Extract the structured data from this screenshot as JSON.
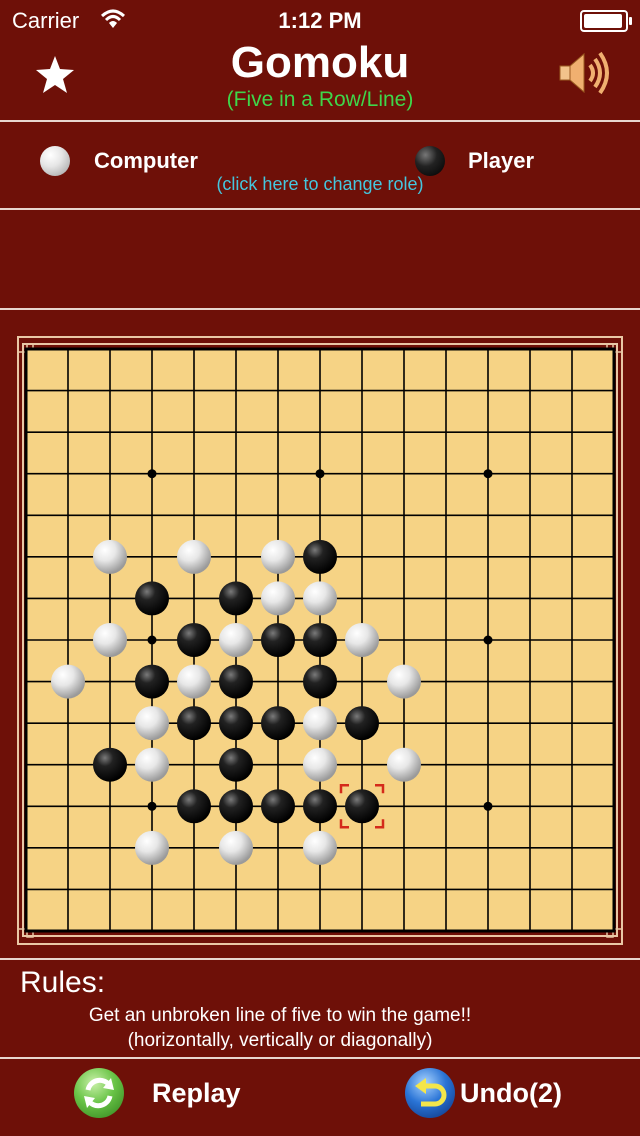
{
  "status_bar": {
    "carrier": "Carrier",
    "time": "1:12 PM",
    "battery_level": 0.95
  },
  "header": {
    "title": "Gomoku",
    "subtitle": "(Five in a Row/Line)",
    "left_icon": "star-icon",
    "right_icon": "speaker-icon"
  },
  "roles": {
    "computer_label": "Computer",
    "computer_stone": "white",
    "player_label": "Player",
    "player_stone": "black",
    "change_hint": "(click here to change role)"
  },
  "board": {
    "size": 15,
    "star_points": [
      [
        3,
        3
      ],
      [
        7,
        3
      ],
      [
        11,
        3
      ],
      [
        3,
        7
      ],
      [
        11,
        7
      ],
      [
        3,
        11
      ],
      [
        11,
        11
      ]
    ],
    "white_stones": [
      [
        2,
        5
      ],
      [
        4,
        5
      ],
      [
        6,
        5
      ],
      [
        6,
        6
      ],
      [
        7,
        6
      ],
      [
        2,
        7
      ],
      [
        5,
        7
      ],
      [
        8,
        7
      ],
      [
        1,
        8
      ],
      [
        4,
        8
      ],
      [
        9,
        8
      ],
      [
        3,
        9
      ],
      [
        7,
        9
      ],
      [
        3,
        10
      ],
      [
        7,
        10
      ],
      [
        9,
        10
      ],
      [
        3,
        12
      ],
      [
        5,
        12
      ],
      [
        7,
        12
      ]
    ],
    "black_stones": [
      [
        7,
        5
      ],
      [
        3,
        6
      ],
      [
        5,
        6
      ],
      [
        4,
        7
      ],
      [
        6,
        7
      ],
      [
        7,
        7
      ],
      [
        3,
        8
      ],
      [
        5,
        8
      ],
      [
        7,
        8
      ],
      [
        4,
        9
      ],
      [
        5,
        9
      ],
      [
        6,
        9
      ],
      [
        8,
        9
      ],
      [
        2,
        10
      ],
      [
        5,
        10
      ],
      [
        4,
        11
      ],
      [
        5,
        11
      ],
      [
        6,
        11
      ],
      [
        7,
        11
      ],
      [
        8,
        11
      ]
    ],
    "last_move": [
      8,
      11
    ],
    "colors": {
      "board": "#f6d385",
      "frame": "#e9c7a6",
      "white_stone": "#ebebeb",
      "black_stone": "#111111",
      "last_move_marker": "#d42a1a"
    }
  },
  "rules": {
    "title": "Rules:",
    "line1": "Get an unbroken line of five  to win the game!!",
    "line2": "(horizontally, vertically or diagonally)"
  },
  "footer": {
    "replay_label": "Replay",
    "replay_icon": "refresh-icon",
    "undo_label": "Undo(2)",
    "undo_icon": "undo-arrow-icon"
  }
}
